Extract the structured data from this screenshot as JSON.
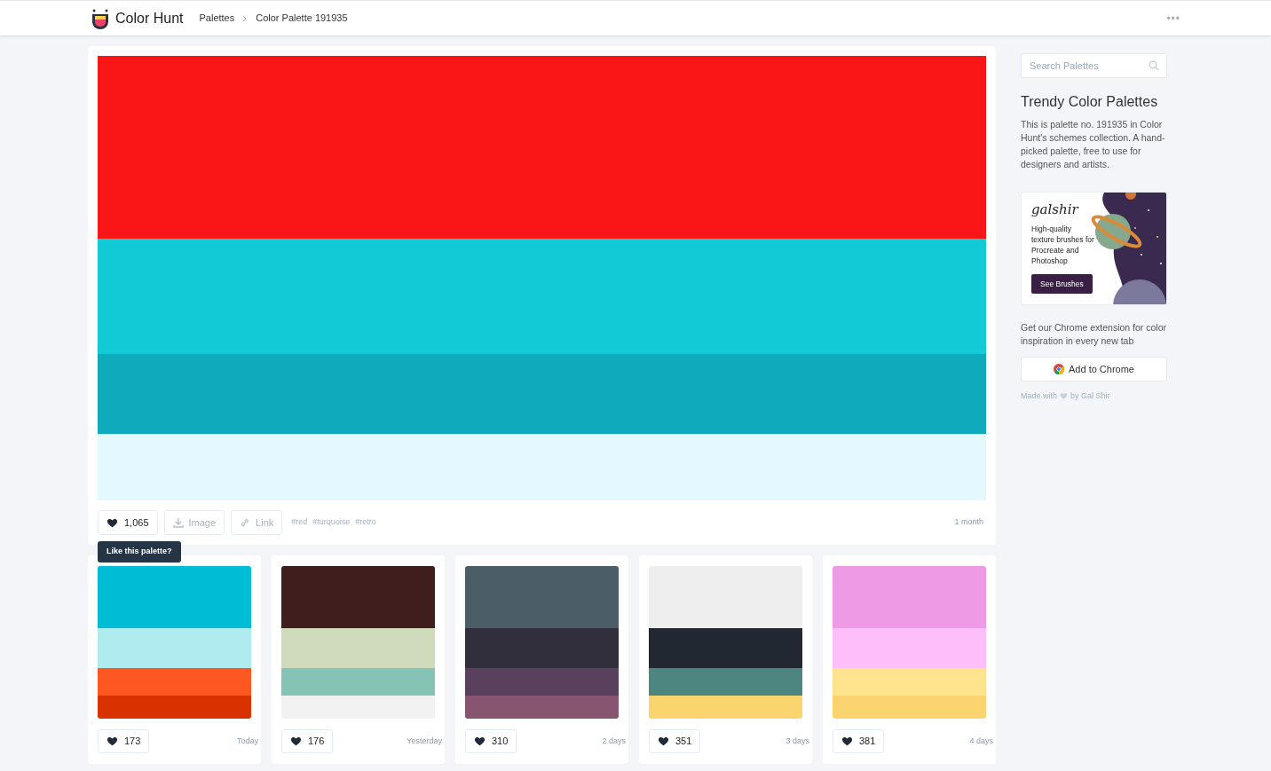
{
  "header": {
    "brand": "Color Hunt",
    "breadcrumbs": [
      "Palettes",
      "Color Palette 191935"
    ],
    "menu": "•••"
  },
  "palette": {
    "bands": [
      {
        "color": "#fa1616"
      },
      {
        "color": "#12cad6"
      },
      {
        "color": "#0fabbc"
      },
      {
        "color": "#e4f9ff"
      }
    ],
    "likes": "1,065",
    "image": "Image",
    "link": "Link",
    "tags": [
      "#red",
      "#turquoise",
      "#retro"
    ],
    "age": "1 month",
    "tooltip": "Like this palette?"
  },
  "related": [
    {
      "bands": [
        {
          "color": "#00bcd4"
        },
        {
          "color": "#b0ebf0"
        },
        {
          "color": "#ff5722"
        },
        {
          "color": "#d93200"
        }
      ],
      "likes": "173",
      "age": "Today"
    },
    {
      "bands": [
        {
          "color": "#411e1e"
        },
        {
          "color": "#d0dbbb"
        },
        {
          "color": "#85c3b7"
        },
        {
          "color": "#f2f2f2"
        }
      ],
      "likes": "176",
      "age": "Yesterday"
    },
    {
      "bands": [
        {
          "color": "#4b5d67"
        },
        {
          "color": "#322f3d"
        },
        {
          "color": "#59405c"
        },
        {
          "color": "#87556f"
        }
      ],
      "likes": "310",
      "age": "2 days"
    },
    {
      "bands": [
        {
          "color": "#eeeeee"
        },
        {
          "color": "#222831"
        },
        {
          "color": "#4d8580"
        },
        {
          "color": "#fad56e"
        }
      ],
      "likes": "351",
      "age": "3 days"
    },
    {
      "bands": [
        {
          "color": "#ee9ae5"
        },
        {
          "color": "#fdbef9"
        },
        {
          "color": "#ffe38d"
        },
        {
          "color": "#fcd46f"
        }
      ],
      "likes": "381",
      "age": "4 days"
    }
  ],
  "sidebar": {
    "search_placeholder": "Search Palettes",
    "title": "Trendy Color Palettes",
    "description": "This is palette no. 191935 in Color Hunt's schemes collection. A hand-picked palette, free to use for designers and artists.",
    "ad": {
      "logo": "galshir",
      "text": "High-quality texture brushes for Procreate and Photoshop",
      "button": "See Brushes"
    },
    "extension_text": "Get our Chrome extension for color inspiration in every new tab",
    "chrome_button": "Add to Chrome",
    "credit_before": "Made with",
    "credit_after": "by Gal Shir"
  }
}
